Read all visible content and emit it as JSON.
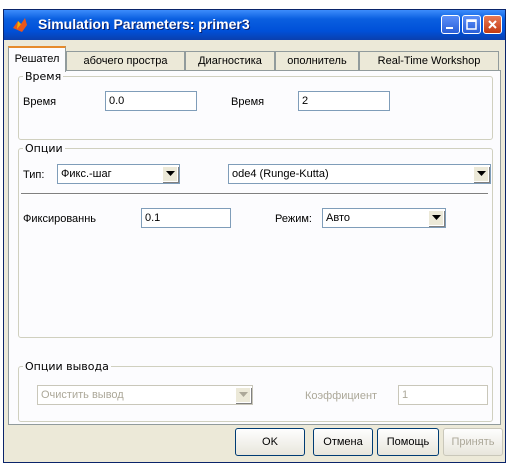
{
  "window": {
    "title": "Simulation Parameters: primer3"
  },
  "tabs": [
    {
      "label": "Решател"
    },
    {
      "label": "абочего простра"
    },
    {
      "label": "Диагностика"
    },
    {
      "label": "ополнитель"
    },
    {
      "label": "Real-Time Workshop"
    }
  ],
  "time_group": {
    "legend": "Время",
    "start_label": "Время",
    "start_value": "0.0",
    "stop_label": "Время",
    "stop_value": "2"
  },
  "options_group": {
    "legend": "Опции",
    "type_label": "Тип:",
    "type_value": "Фикс.-шаг",
    "solver_value": "ode4 (Runge-Kutta)",
    "fixed_step_label": "Фиксированнь",
    "fixed_step_value": "0.1",
    "mode_label": "Режим:",
    "mode_value": "Авто"
  },
  "output_group": {
    "legend": "Опции вывода",
    "output_value": "Очистить вывод",
    "factor_label": "Коэффициент",
    "factor_value": "1"
  },
  "buttons": {
    "ok": "OK",
    "cancel": "Отмена",
    "help": "Помощь",
    "apply": "Принять"
  },
  "colors": {
    "title_bar": "#0050d8",
    "active_tab_accent": "#e68b2c",
    "close_button": "#c23a12"
  }
}
